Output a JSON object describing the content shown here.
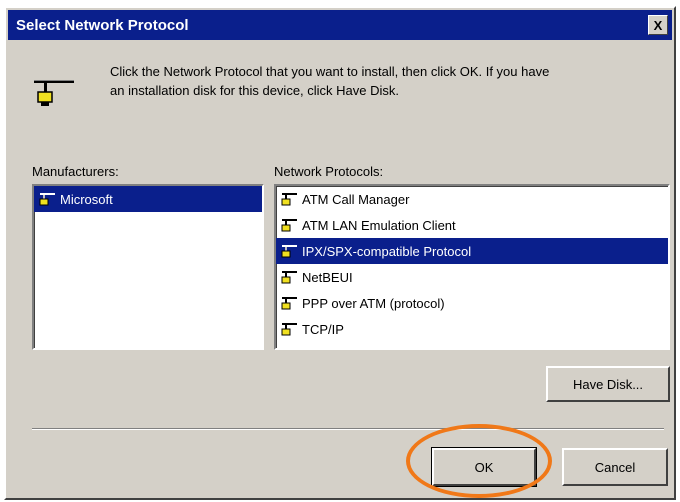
{
  "window": {
    "title": "Select Network Protocol",
    "close_symbol": "X"
  },
  "instruction": {
    "line1": "Click the Network Protocol that you want to install, then click OK. If you have",
    "line2": "an installation disk for this device, click Have Disk."
  },
  "manufacturers": {
    "label": "Manufacturers:",
    "items": [
      {
        "label": "Microsoft",
        "selected": true
      }
    ]
  },
  "protocols": {
    "label": "Network Protocols:",
    "items": [
      {
        "label": "ATM Call Manager",
        "selected": false
      },
      {
        "label": "ATM LAN Emulation Client",
        "selected": false
      },
      {
        "label": "IPX/SPX-compatible Protocol",
        "selected": true
      },
      {
        "label": "NetBEUI",
        "selected": false
      },
      {
        "label": "PPP over ATM (protocol)",
        "selected": false
      },
      {
        "label": "TCP/IP",
        "selected": false
      }
    ]
  },
  "buttons": {
    "have_disk": "Have Disk...",
    "ok": "OK",
    "cancel": "Cancel"
  },
  "colors": {
    "titlebar": "#0a1f8c",
    "selection": "#0a1f8c",
    "face": "#d4d0c8",
    "highlight_ring": "#f07818"
  },
  "icons": {
    "header": "network-protocol-icon",
    "list_item": "protocol-plug-icon"
  }
}
